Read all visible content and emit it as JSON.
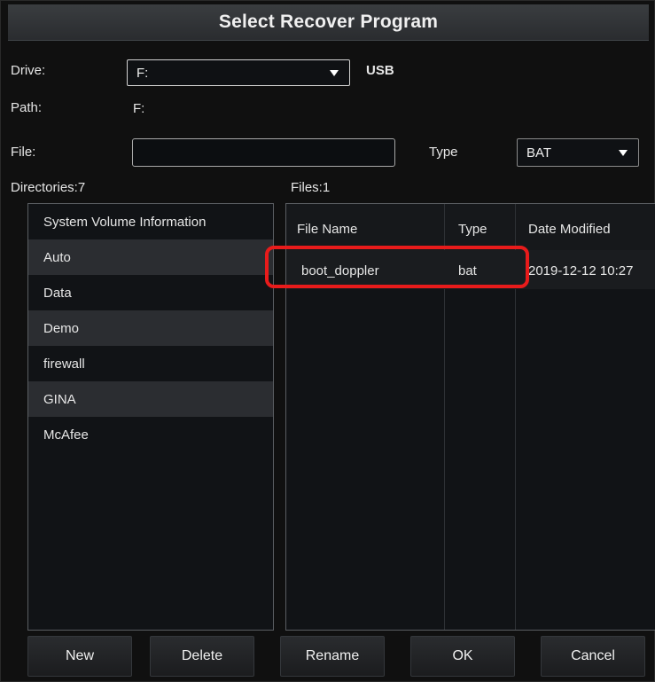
{
  "dialog": {
    "title": "Select Recover Program"
  },
  "drive": {
    "label": "Drive:",
    "value": "F:",
    "type_label": "USB"
  },
  "path": {
    "label": "Path:",
    "value": "F:"
  },
  "file": {
    "label": "File:",
    "value": ""
  },
  "type_filter": {
    "label": "Type",
    "value": "BAT"
  },
  "directories": {
    "header": "Directories:7",
    "items": [
      "System Volume Information",
      "Auto",
      "Data",
      "Demo",
      "firewall",
      "GINA",
      "McAfee"
    ]
  },
  "files": {
    "header": "Files:1",
    "columns": [
      "File Name",
      "Type",
      "Date Modified"
    ],
    "rows": [
      {
        "name": "boot_doppler",
        "type": "bat",
        "date": "2019-12-12 10:27"
      }
    ]
  },
  "buttons": {
    "new": "New",
    "delete": "Delete",
    "rename": "Rename",
    "ok": "OK",
    "cancel": "Cancel"
  },
  "colors": {
    "background": "#101010",
    "highlight": "#e81b1b",
    "row_alt": "#2b2d31"
  },
  "icons": {
    "dropdown": "chevron-down-icon"
  }
}
